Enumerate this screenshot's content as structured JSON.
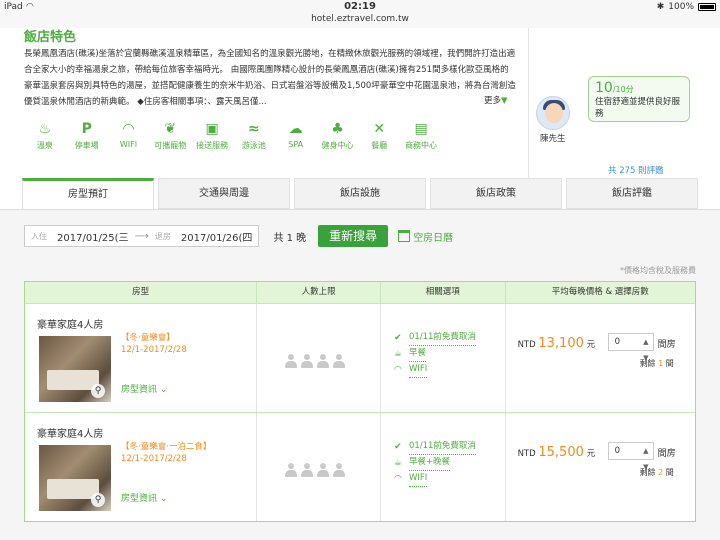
{
  "status": {
    "device": "iPad",
    "time": "02:19",
    "battery": "100%"
  },
  "url": "hotel.eztravel.com.tw",
  "hotel": {
    "section_title": "飯店特色",
    "description": "長榮鳳凰酒店(礁溪)坐落於宜蘭縣礁溪溫泉精華區，為全國知名的溫泉觀光勝地，在精緻休旅觀光服務的領域裡，我們開許打造出適合全家大小的幸福湯泉之旅，帶給每位旅客幸福時光。 由國際風團隊精心設計的長榮鳳凰酒店(礁溪)擁有251間多樣化歐亞風格的豪華溫泉套房與別具特色的湯屋，並搭配健康養生的奈米牛奶浴、日式岩盤浴等設備及1,500坪豪華空中花園溫泉池，將為台灣創造優質溫泉休閒酒店的新典範。 ◆住房客相關事項：、露天風呂僅...",
    "more_label": "更多",
    "amenities": [
      {
        "icon": "hot-spring-icon",
        "label": "溫泉"
      },
      {
        "icon": "parking-icon",
        "label": "停車場"
      },
      {
        "icon": "wifi-icon",
        "label": "WIFI"
      },
      {
        "icon": "pet-icon",
        "label": "可攜寵物"
      },
      {
        "icon": "shuttle-icon",
        "label": "接送服務"
      },
      {
        "icon": "swimming-icon",
        "label": "游泳池"
      },
      {
        "icon": "spa-icon",
        "label": "SPA"
      },
      {
        "icon": "fitness-icon",
        "label": "健身中心"
      },
      {
        "icon": "restaurant-icon",
        "label": "餐廳"
      },
      {
        "icon": "business-icon",
        "label": "商務中心"
      }
    ]
  },
  "review": {
    "score": "10",
    "score_max": "/10分",
    "text": "住宿舒適並提供良好服務",
    "reviewer": "陳先生",
    "count_link": "共 275 則評鑑"
  },
  "tabs": [
    "房型預訂",
    "交通與周邊",
    "飯店設施",
    "飯店政策",
    "飯店評鑑"
  ],
  "search": {
    "checkin_label": "入住",
    "checkin": "2017/01/25(三",
    "checkout_label": "退房",
    "checkout": "2017/01/26(四",
    "nights": "共 1 晚",
    "button": "重新搜尋",
    "calendar": "空房日曆"
  },
  "tax_note": "*價格均含稅及服務費",
  "table": {
    "headers": [
      "房型",
      "人數上限",
      "相關選項",
      "平均每晚價格 & 選擇房數"
    ],
    "rows": [
      {
        "name": "豪華家庭4人房",
        "promo": "【冬‧童樂會】",
        "period": "12/1-2017/2/28",
        "info": "房型資訊",
        "options": [
          "01/11前免費取消",
          "早餐",
          "WIFI"
        ],
        "currency": "NTD",
        "price": "13,100",
        "price_unit": "元",
        "select": "0",
        "room_unit": "間房",
        "remain_prefix": "剩餘",
        "remain": "1",
        "remain_suffix": "間"
      },
      {
        "name": "豪華家庭4人房",
        "promo": "【冬‧童樂會‧一泊二食】",
        "period": "12/1-2017/2/28",
        "info": "房型資訊",
        "options": [
          "01/11前免費取消",
          "早餐+晚餐",
          "WIFI"
        ],
        "currency": "NTD",
        "price": "15,500",
        "price_unit": "元",
        "select": "0",
        "room_unit": "間房",
        "remain_prefix": "剩餘",
        "remain": "2",
        "remain_suffix": "間"
      }
    ]
  }
}
